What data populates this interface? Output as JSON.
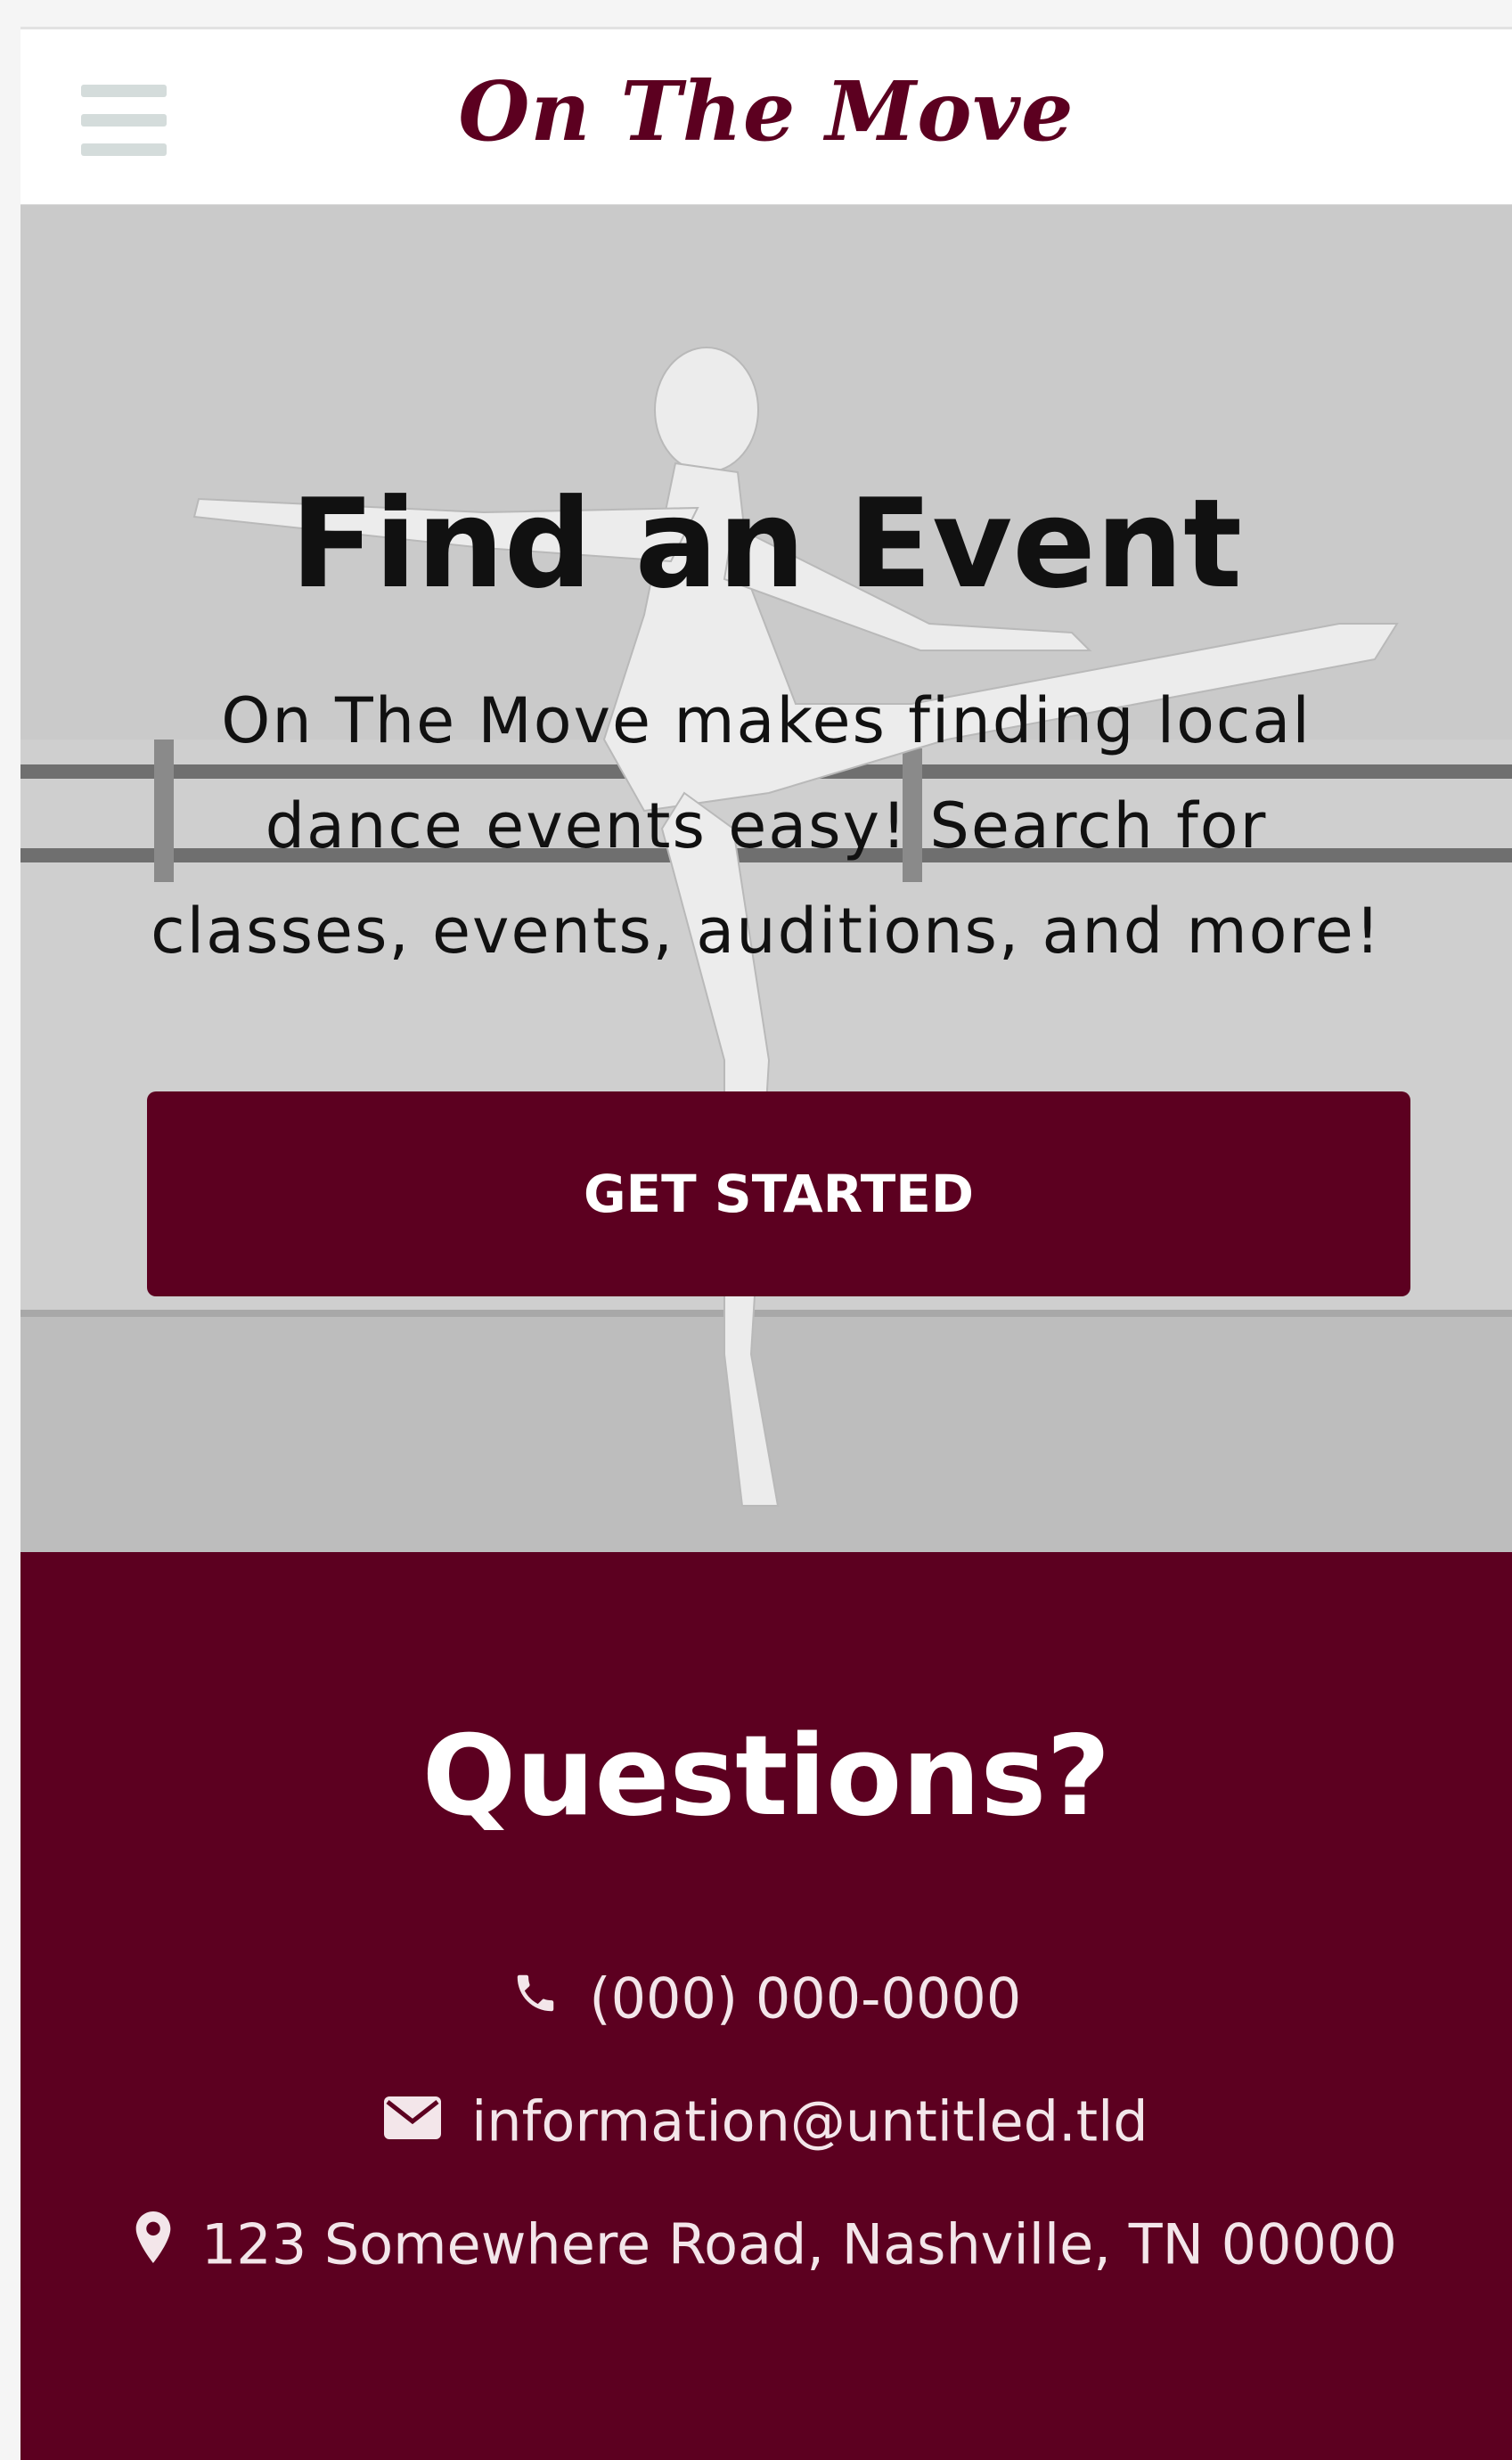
{
  "header": {
    "menu_icon": "hamburger-menu-icon",
    "brand": "On The Move"
  },
  "hero": {
    "title": "Find an Event",
    "text": "On The Move makes finding local dance events easy! Search for classes, events, auditions, and more!",
    "cta_label": "GET STARTED"
  },
  "questions": {
    "title": "Questions?",
    "phone": "(000) 000-0000",
    "email": "information@untitled.tld",
    "address": "123 Somewhere Road, Nashville, TN 00000",
    "icons": {
      "phone": "phone-icon",
      "email": "envelope-icon",
      "address": "map-marker-icon"
    }
  },
  "colors": {
    "brand": "#5c0020",
    "menu_icon": "#d4dcdb",
    "contact_text": "#f3e6ea"
  }
}
